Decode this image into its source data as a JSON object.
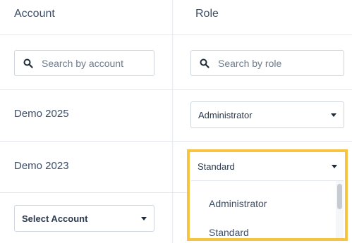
{
  "columns": {
    "account_header": "Account",
    "role_header": "Role"
  },
  "search": {
    "account_placeholder": "Search by account",
    "role_placeholder": "Search by role"
  },
  "rows": [
    {
      "account": "Demo 2025",
      "role": "Administrator"
    },
    {
      "account": "Demo 2023",
      "role": "Standard"
    }
  ],
  "new_row": {
    "account_select": "Select Account"
  },
  "role_dropdown": {
    "options": [
      "Administrator",
      "Standard"
    ]
  },
  "colors": {
    "highlight": "#f6c343",
    "text": "#3e4f68",
    "border": "#cfd5dc"
  }
}
